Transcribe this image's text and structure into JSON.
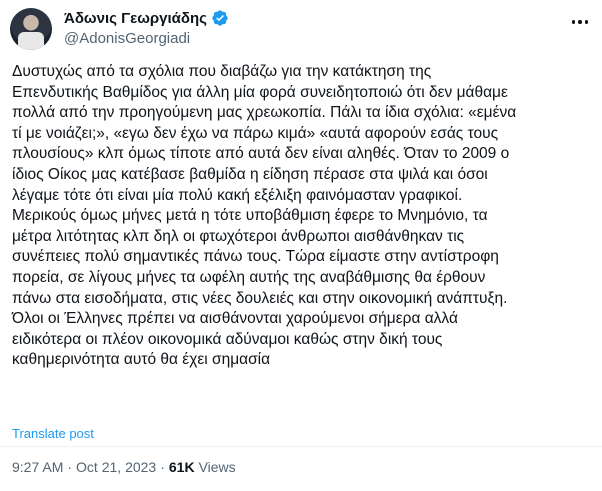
{
  "author": {
    "display_name": "Άδωνις Γεωργιάδης",
    "handle": "@AdonisGeorgiadi"
  },
  "tweet": {
    "text": "Δυστυχώς από τα σχόλια που διαβάζω για την κατάκτηση της\nΕπενδυτικής Βαθμίδος για άλλη μία φορά συνειδητοποιώ ότι δεν μάθαμε\nπολλά από την προηγούμενη μας χρεωκοπία. Πάλι τα ίδια σχόλια: «εμένα\nτί με νοιάζει;», «εγω δεν έχω να πάρω κιμά» «αυτά αφορούν εσάς τους\nπλουσίους» κλπ όμως τίποτε από αυτά δεν είναι αληθές. Όταν το 2009 ο\nίδιος Οίκος μας κατέβασε βαθμίδα η είδηση πέρασε στα ψιλά και όσοι\nλέγαμε τότε ότι είναι μία πολύ κακή εξέλιξη φαινόμασταν γραφικοί.\nΜερικούς όμως μήνες μετά η τότε υποβάθμιση έφερε το Μνημόνιο, τα\nμέτρα λιτότητας κλπ δηλ οι φτωχότεροι άνθρωποι αισθάνθηκαν τις\nσυνέπειες πολύ σημαντικές πάνω τους. Τώρα είμαστε στην αντίστροφη\nπορεία, σε λίγους μήνες τα ωφέλη αυτής της αναβάθμισης θα έρθουν\nπάνω στα εισοδήματα, στις νέες δουλειές και στην οικονομική ανάπτυξη.\nΌλοι οι Έλληνες πρέπει να αισθάνονται χαρούμενοι σήμερα αλλά\nειδικότερα οι πλέον οικονομικά αδύναμοι καθώς στην δική τους\nκαθημερινότητα αυτό θα έχει σημασία",
    "translate_label": "Translate post"
  },
  "meta": {
    "time": "9:27 AM",
    "separator": "·",
    "date": "Oct 21, 2023",
    "separator2": "·",
    "views_count": "61K",
    "views_label": "Views"
  },
  "icons": {
    "verified": "verified-badge-icon",
    "more": "more-options-icon"
  },
  "colors": {
    "accent": "#1d9bf0",
    "text": "#0f1419",
    "secondary": "#536471",
    "divider": "#eff3f4"
  }
}
